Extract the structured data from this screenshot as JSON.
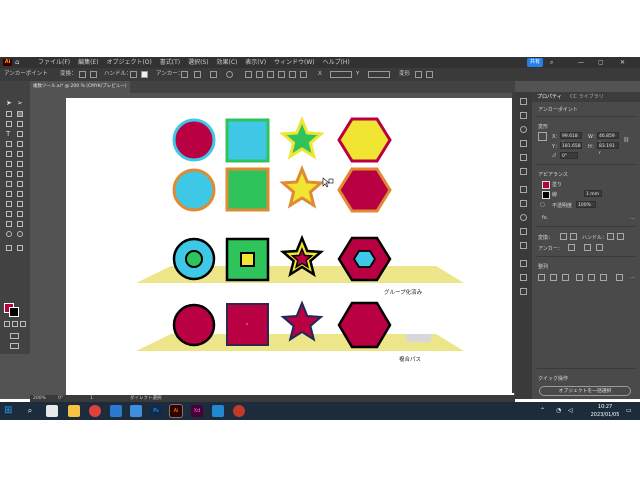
{
  "menubar": {
    "logo": "Ai",
    "items": [
      "ファイル(F)",
      "編集(E)",
      "オブジェクト(O)",
      "書式(T)",
      "選択(S)",
      "効果(C)",
      "表示(V)",
      "ウィンドウ(W)",
      "ヘルプ(H)"
    ],
    "share_label": "共有"
  },
  "controlbar": {
    "selection_label": "アンカーポイント",
    "convert_label": "変換：",
    "handle_label": "ハンドル：",
    "anchor_label": "アンカー：",
    "transform_label": "変形"
  },
  "document": {
    "tab_title": "複数ツール.ai* @ 200 % (CMYK/プレビュー)"
  },
  "artboard": {
    "label_group": "グループ化済み",
    "label_compound": "複合パス"
  },
  "statusbar": {
    "zoom": "200%",
    "angle": "0°",
    "page": "1",
    "tool": "ダイレクト選択"
  },
  "properties": {
    "tab_properties": "プロパティ",
    "tab_libraries": "CC ライブラリ",
    "section_anchor": "アンカーポイント",
    "section_transform": "変形",
    "x_label": "X：",
    "x_value": "99.618 r",
    "y_label": "Y：",
    "y_value": "181.658",
    "w_label": "W：",
    "w_value": "46.859 r",
    "h_label": "H：",
    "h_value": "83.191 r",
    "angle_value": "0°",
    "section_appearance": "アピアランス",
    "fill_label": "塗り",
    "stroke_label": "線",
    "stroke_value": "1 mm",
    "opacity_label": "不透明度",
    "opacity_value": "100%",
    "fx_label": "fx.",
    "convert_label": "変換：",
    "handle_label": "ハンドル：",
    "anchor_label": "アンカー：",
    "section_align": "整列",
    "section_quick": "クイック操作",
    "deselect_button": "オブジェクトを一括選択"
  },
  "taskbar": {
    "time": "10:27",
    "date": "2023/01/05"
  },
  "colors": {
    "crimson": "#b90042",
    "cyan": "#3ec8e6",
    "green": "#2fc35c",
    "yellow": "#f0e532",
    "orange_stroke": "#e08a33",
    "shadow_yellow": "#ece58a",
    "ai_orange": "#ff9a00"
  }
}
